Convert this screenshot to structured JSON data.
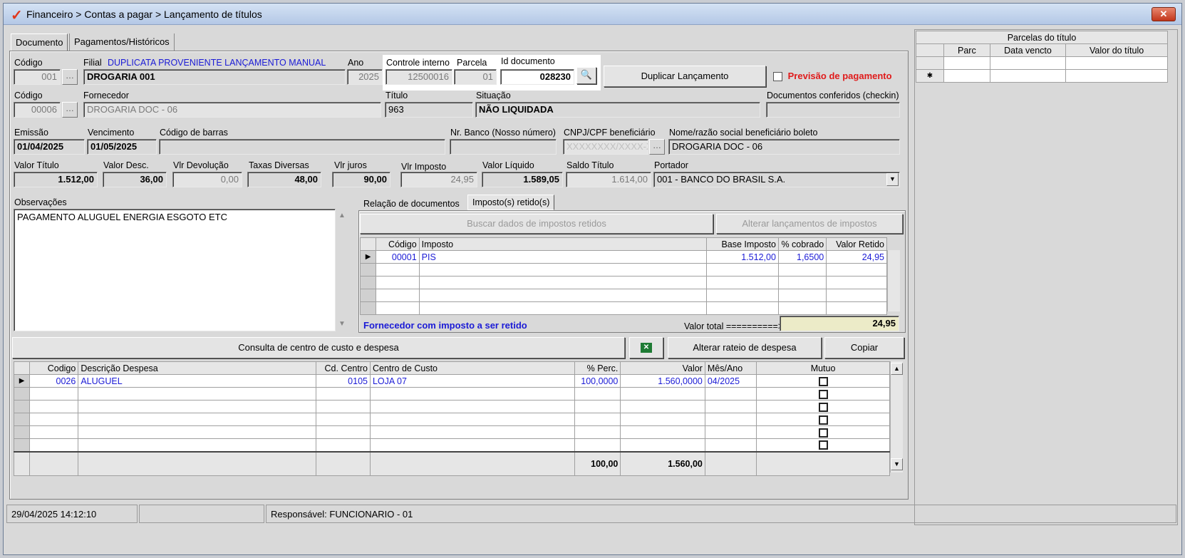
{
  "window": {
    "title": "Financeiro > Contas a pagar > Lançamento de títulos",
    "close": "✕"
  },
  "tabs": [
    "Documento",
    "Pagamentos/Históricos"
  ],
  "header": {
    "codigo_label": "Código",
    "codigo": "001",
    "filial_label": "Filial",
    "filial_note": "DUPLICATA PROVENIENTE LANÇAMENTO MANUAL",
    "filial": "DROGARIA 001",
    "ano_label": "Ano",
    "ano": "2025",
    "controle_label": "Controle interno",
    "controle": "12500016",
    "parcela_label": "Parcela",
    "parcela": "01",
    "iddoc_label": "Id documento",
    "iddoc": "028230",
    "duplicar": "Duplicar Lançamento",
    "previsao": "Previsão de pagamento"
  },
  "fornecedor": {
    "codigo_label": "Código",
    "codigo": "00006",
    "label": "Fornecedor",
    "value": "DROGARIA DOC - 06",
    "titulo_label": "Título",
    "titulo": "963",
    "situacao_label": "Situação",
    "situacao": "NÃO LIQUIDADA",
    "docs_label": "Documentos conferidos (checkin)"
  },
  "dates": {
    "emissao_label": "Emissão",
    "emissao": "01/04/2025",
    "venc_label": "Vencimento",
    "venc": "01/05/2025",
    "barras_label": "Código de barras",
    "banco_label": "Nr. Banco (Nosso número)",
    "cnpj_label": "CNPJ/CPF beneficiário",
    "cnpj": "XXXXXXXX/XXXX-XX",
    "nome_label": "Nome/razão social beneficiário boleto",
    "nome": "DROGARIA DOC - 06"
  },
  "values": {
    "valor_titulo_label": "Valor Título",
    "valor_titulo": "1.512,00",
    "desc_label": "Valor Desc.",
    "desc": "36,00",
    "devol_label": "Vlr Devolução",
    "devol": "0,00",
    "taxas_label": "Taxas Diversas",
    "taxas": "48,00",
    "juros_label": "Vlr juros",
    "juros": "90,00",
    "imposto_label": "Vlr Imposto",
    "imposto": "24,95",
    "liquido_label": "Valor Líquido",
    "liquido": "1.589,05",
    "saldo_label": "Saldo Título",
    "saldo": "1.614,00",
    "portador_label": "Portador",
    "portador": "001 - BANCO DO BRASIL S.A."
  },
  "obs": {
    "label": "Observações",
    "text": "PAGAMENTO ALUGUEL  ENERGIA  ESGOTO  ETC"
  },
  "impostos": {
    "tab1": "Relação de documentos",
    "tab2": "Imposto(s) retido(s)",
    "buscar": "Buscar dados de impostos retidos",
    "alterar": "Alterar lançamentos de impostos",
    "cols": [
      "Código",
      "Imposto",
      "Base Imposto",
      "% cobrado",
      "Valor Retido"
    ],
    "row": {
      "codigo": "00001",
      "imposto": "PIS",
      "base": "1.512,00",
      "pct": "1,6500",
      "retido": "24,95"
    },
    "note": "Fornecedor com imposto a ser retido",
    "total_label": "Valor total ==========>",
    "total": "24,95"
  },
  "centro": {
    "consulta": "Consulta de centro de custo e despesa",
    "alterar": "Alterar rateio de despesa",
    "copiar": "Copiar",
    "cols": [
      "Codigo",
      "Descrição Despesa",
      "Cd. Centro",
      "Centro de Custo",
      "% Perc.",
      "Valor",
      "Mês/Ano",
      "Mutuo"
    ],
    "row": {
      "codigo": "0026",
      "desc": "ALUGUEL",
      "cd": "0105",
      "centro": "LOJA 07",
      "perc": "100,0000",
      "valor": "1.560,0000",
      "mes": "04/2025"
    },
    "tot_perc": "100,00",
    "tot_valor": "1.560,00"
  },
  "parcelas": {
    "title": "Parcelas do título",
    "cols": [
      "Parc",
      "Data vencto",
      "Valor do título"
    ]
  },
  "status": {
    "datetime": "29/04/2025 14:12:10",
    "resp": "Responsável: FUNCIONARIO - 01"
  },
  "colors": {
    "blue": "#1b1bd6",
    "red": "#e01b1b"
  }
}
